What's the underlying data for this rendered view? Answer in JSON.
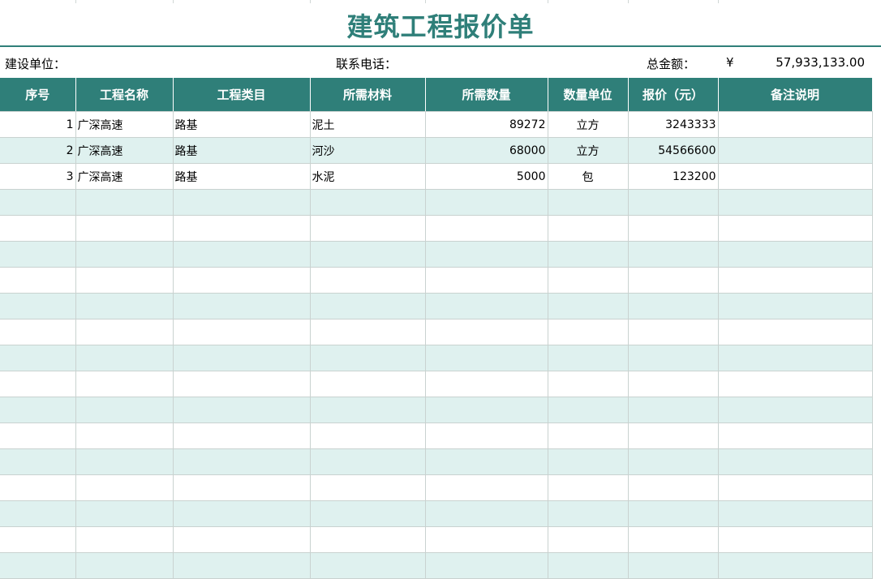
{
  "sheet": {
    "title": "建筑工程报价单",
    "info": {
      "builder_label": "建设单位：",
      "phone_label": "联系电话：",
      "total_label": "总金额：",
      "currency_symbol": "¥",
      "total_value": "57,933,133.00"
    },
    "headers": [
      "序号",
      "工程名称",
      "工程类目",
      "所需材料",
      "所需数量",
      "数量单位",
      "报价（元）",
      "备注说明"
    ],
    "rows": [
      {
        "no": "1",
        "project": "广深高速",
        "category": "路基",
        "material": "泥土",
        "quantity": "89272",
        "unit": "立方",
        "price": "3243333",
        "note": ""
      },
      {
        "no": "2",
        "project": "广深高速",
        "category": "路基",
        "material": "河沙",
        "quantity": "68000",
        "unit": "立方",
        "price": "54566600",
        "note": ""
      },
      {
        "no": "3",
        "project": "广深高速",
        "category": "路基",
        "material": "水泥",
        "quantity": "5000",
        "unit": "包",
        "price": "123200",
        "note": ""
      }
    ]
  },
  "colors": {
    "accent": "#2f7f79",
    "stripe": "#dff1ef",
    "grid": "#c9d2d0"
  }
}
